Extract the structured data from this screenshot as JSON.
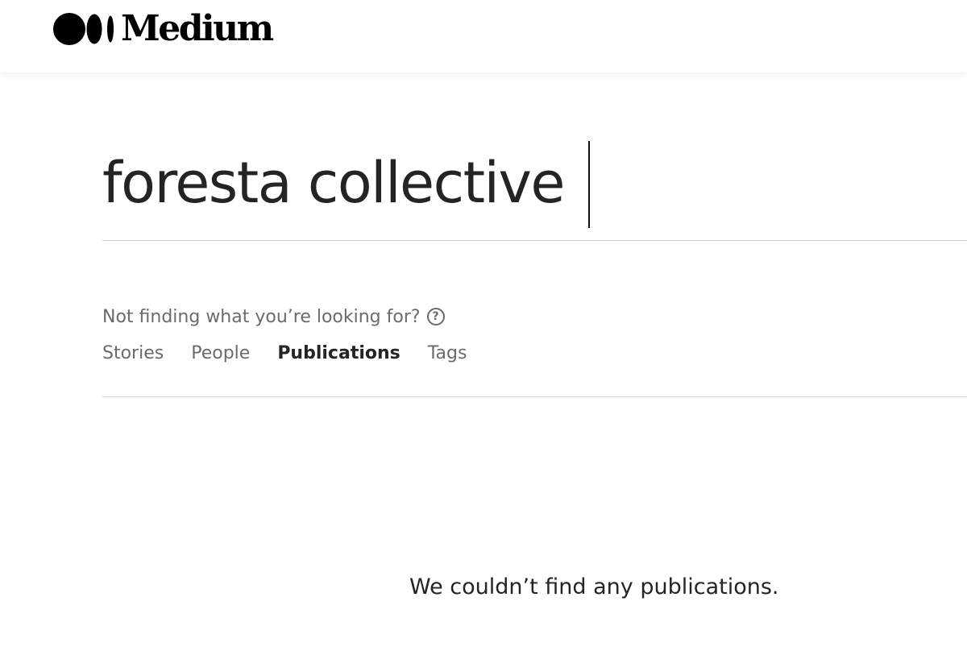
{
  "header": {
    "logo_text": "Medium"
  },
  "search": {
    "query": "foresta collective"
  },
  "help": {
    "text": "Not finding what you’re looking for?",
    "icon": "question-circle-icon"
  },
  "tabs": [
    {
      "label": "Stories",
      "active": false
    },
    {
      "label": "People",
      "active": false
    },
    {
      "label": "Publications",
      "active": true
    },
    {
      "label": "Tags",
      "active": false
    }
  ],
  "results": {
    "empty_message": "We couldn’t find any publications."
  }
}
